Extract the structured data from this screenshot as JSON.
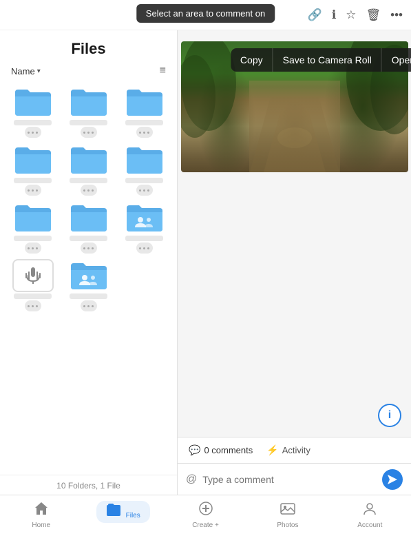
{
  "topbar": {
    "tooltip": "Select an area to comment on",
    "icons": [
      "link",
      "info",
      "star",
      "trash",
      "more"
    ]
  },
  "files": {
    "title": "Files",
    "sort_label": "Name",
    "folders": [
      [
        {
          "type": "folder",
          "name_blur": true,
          "shared": false
        },
        {
          "type": "folder",
          "name_blur": true,
          "shared": false
        },
        {
          "type": "folder",
          "name_blur": true,
          "shared": false
        }
      ],
      [
        {
          "type": "folder",
          "name_blur": true,
          "shared": false
        },
        {
          "type": "folder",
          "name_blur": true,
          "shared": false
        },
        {
          "type": "folder",
          "name_blur": true,
          "shared": false
        }
      ],
      [
        {
          "type": "folder",
          "name_blur": true,
          "shared": false
        },
        {
          "type": "folder",
          "name_blur": true,
          "shared": false
        },
        {
          "type": "folder",
          "name_blur": true,
          "shared": true
        }
      ],
      [
        {
          "type": "voice",
          "name_blur": true,
          "shared": false
        },
        {
          "type": "folder_people",
          "name_blur": true,
          "shared": true
        }
      ]
    ],
    "footer": "10 Folders, 1 File"
  },
  "context_menu": {
    "items": [
      "Copy",
      "Save to Camera Roll",
      "Open in..."
    ]
  },
  "comments": {
    "comments_label": "0 comments",
    "activity_label": "Activity"
  },
  "comment_input": {
    "placeholder": "Type a comment"
  },
  "info_button_label": "i",
  "bottom_nav": {
    "items": [
      {
        "label": "Home",
        "icon": "🏠",
        "active": false
      },
      {
        "label": "Files",
        "icon": "📁",
        "active": true
      },
      {
        "label": "Create +",
        "icon": "➕",
        "active": false
      },
      {
        "label": "Photos",
        "icon": "👤",
        "active": false
      },
      {
        "label": "Account",
        "icon": "👤",
        "active": false
      }
    ]
  }
}
